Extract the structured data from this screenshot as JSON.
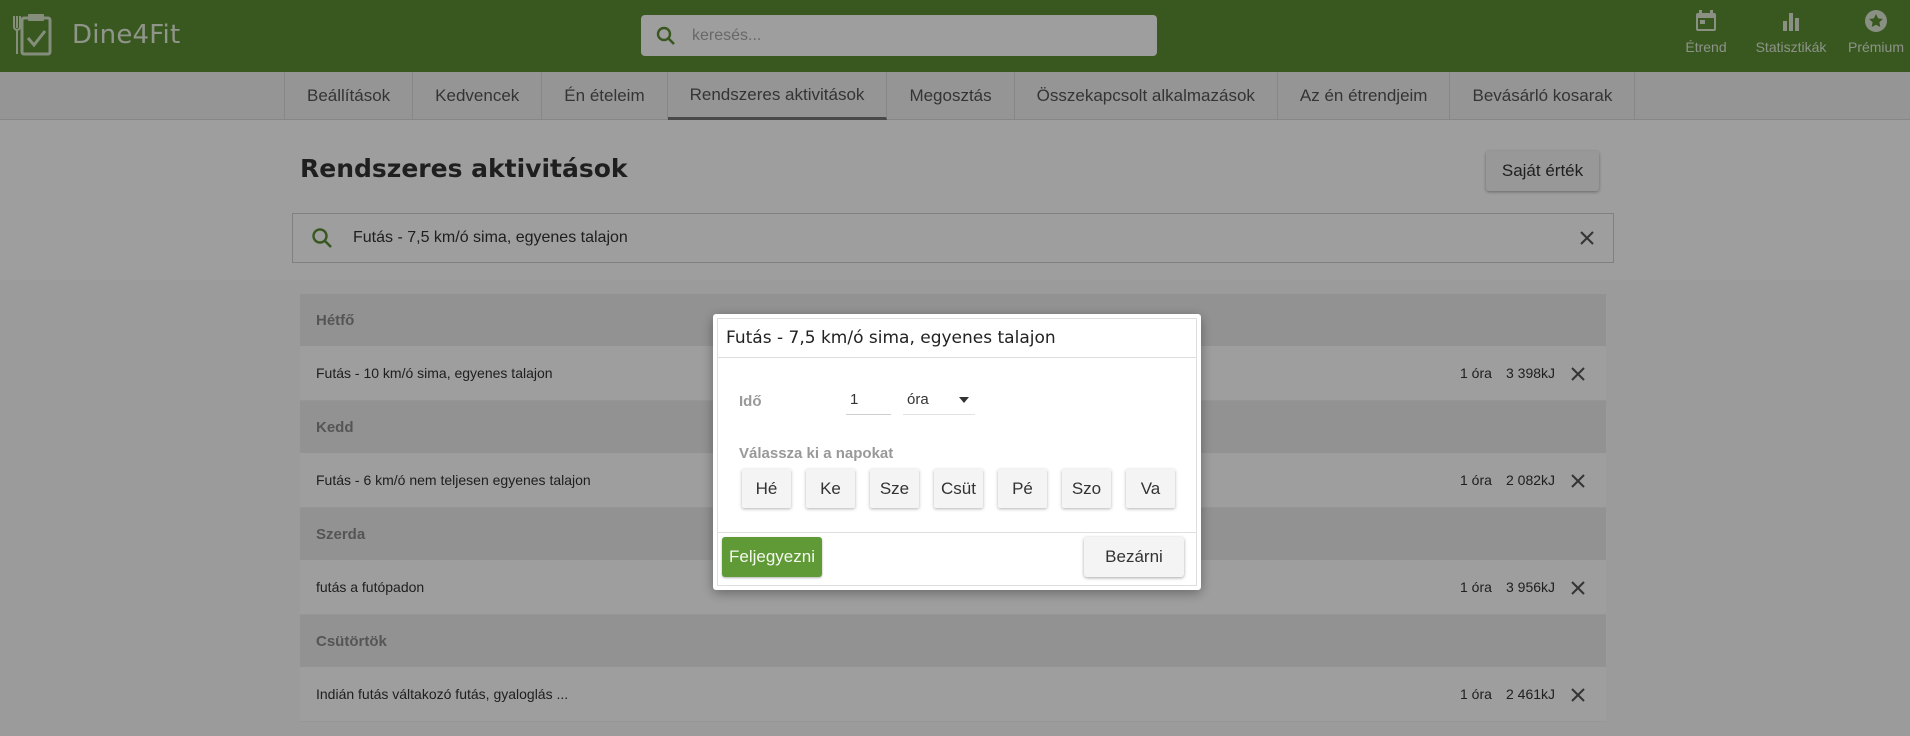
{
  "app": {
    "name": "Dine4Fit"
  },
  "search": {
    "placeholder": "keresés..."
  },
  "topnav": [
    {
      "label": "Étrend",
      "icon": "calendar-icon"
    },
    {
      "label": "Statisztikák",
      "icon": "bar-chart-icon"
    },
    {
      "label": "Prémium",
      "icon": "star-icon"
    }
  ],
  "tabs": [
    {
      "label": "Beállítások"
    },
    {
      "label": "Kedvencek"
    },
    {
      "label": "Én ételeim"
    },
    {
      "label": "Rendszeres aktivitások",
      "active": true
    },
    {
      "label": "Megosztás"
    },
    {
      "label": "Összekapcsolt alkalmazások"
    },
    {
      "label": "Az én étrendjeim"
    },
    {
      "label": "Bevásárló kosarak"
    }
  ],
  "page": {
    "title": "Rendszeres aktivitások",
    "custom_button": "Saját érték",
    "activity_search_value": "Futás - 7,5 km/ó sima, egyenes talajon"
  },
  "days": [
    {
      "name": "Hétfő",
      "activity": "Futás - 10 km/ó sima, egyenes talajon",
      "duration": "1 óra",
      "energy": "3 398kJ"
    },
    {
      "name": "Kedd",
      "activity": "Futás - 6 km/ó nem teljesen egyenes talajon",
      "duration": "1 óra",
      "energy": "2 082kJ"
    },
    {
      "name": "Szerda",
      "activity": "futás a futópadon",
      "duration": "1 óra",
      "energy": "3 956kJ"
    },
    {
      "name": "Csütörtök",
      "activity": "Indián futás váltakozó futás, gyaloglás ...",
      "duration": "1 óra",
      "energy": "2 461kJ"
    }
  ],
  "modal": {
    "title": "Futás - 7,5 km/ó sima, egyenes talajon",
    "time_label": "Idő",
    "time_value": "1",
    "unit": "óra",
    "days_label": "Válassza ki a napokat",
    "day_buttons": [
      "Hé",
      "Ke",
      "Sze",
      "Csüt",
      "Pé",
      "Szo",
      "Va"
    ],
    "save_button": "Feljegyezni",
    "close_button": "Bezárni"
  },
  "colors": {
    "header_green": "#5b8e33",
    "button_green": "#5f9a37"
  }
}
